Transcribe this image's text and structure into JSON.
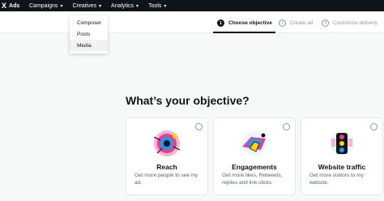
{
  "header": {
    "brand_logo": "X",
    "brand_text": "Ads",
    "nav": [
      {
        "label": "Campaigns",
        "icon": "chevron-down-icon"
      },
      {
        "label": "Creatives",
        "icon": "chevron-down-icon"
      },
      {
        "label": "Analytics",
        "icon": "chevron-down-icon"
      },
      {
        "label": "Tools",
        "icon": "chevron-down-icon"
      }
    ]
  },
  "creatives_menu": {
    "items": [
      "Composer",
      "Posts",
      "Media"
    ],
    "hovered": "Media"
  },
  "steps": [
    {
      "number": "1",
      "label": "Choose objective",
      "active": true
    },
    {
      "number": "2",
      "label": "Create ad",
      "active": false
    },
    {
      "number": "3",
      "label": "Customize delivery",
      "active": false
    }
  ],
  "main": {
    "heading": "What’s your objective?",
    "objectives": [
      {
        "title": "Reach",
        "description": "Get more people to see my ad.",
        "icon": "reach-illustration"
      },
      {
        "title": "Engagements",
        "description": "Get more likes, Retweets, replies and link clicks.",
        "icon": "engagements-illustration"
      },
      {
        "title": "Website traffic",
        "description": "Get more visitors to my website.",
        "icon": "website-traffic-illustration"
      }
    ]
  },
  "colors": {
    "topbar": "#0f1419",
    "page_bg": "#f7f9f9",
    "accent_pink": "#e83e8c",
    "accent_blue": "#1d9bf0"
  }
}
